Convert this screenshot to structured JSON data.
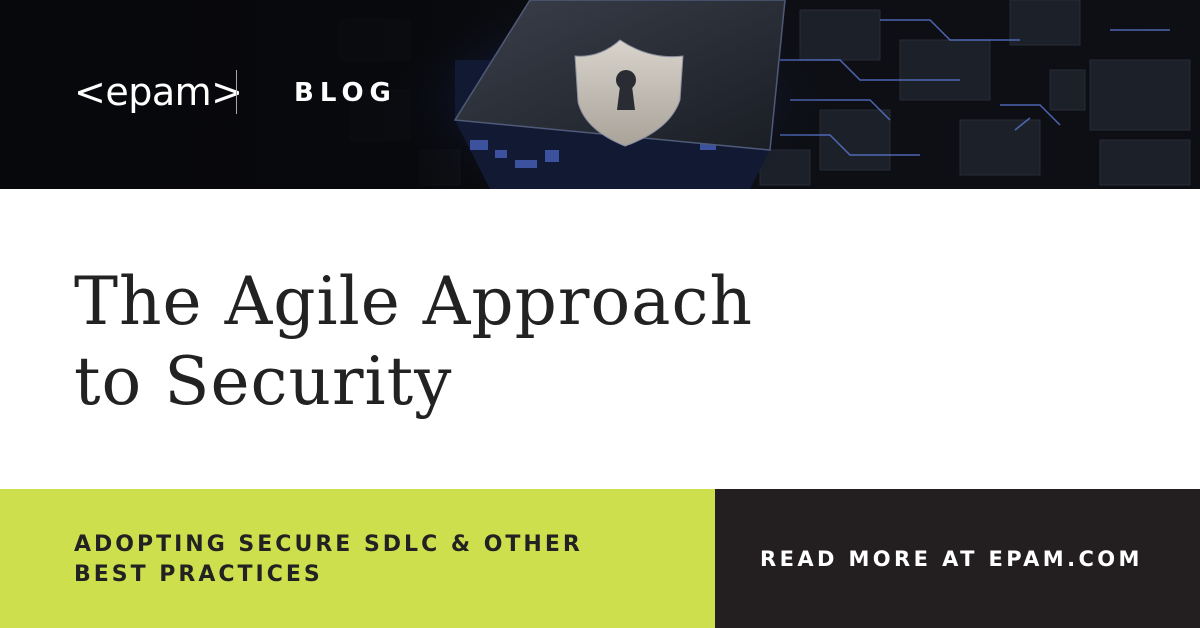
{
  "brand": {
    "logo_text": "<epam>",
    "section_label": "BLOG"
  },
  "hero_image": {
    "icons": [
      "shield-keyhole-icon",
      "circuit-chip"
    ],
    "colors": {
      "background": "#0b0c10",
      "glow": "#4b6cff",
      "shield": "#c9c4bd"
    }
  },
  "headline": {
    "line1": "The Agile Approach",
    "line2": "to Security"
  },
  "subtitle": {
    "line1": "ADOPTING SECURE SDLC & OTHER",
    "line2": "BEST PRACTICES"
  },
  "cta": {
    "label": "READ MORE AT EPAM.COM"
  },
  "colors": {
    "accent_green": "#cedf4d",
    "dark_panel": "#231f20",
    "text_dark": "#222222",
    "text_light": "#ffffff"
  }
}
